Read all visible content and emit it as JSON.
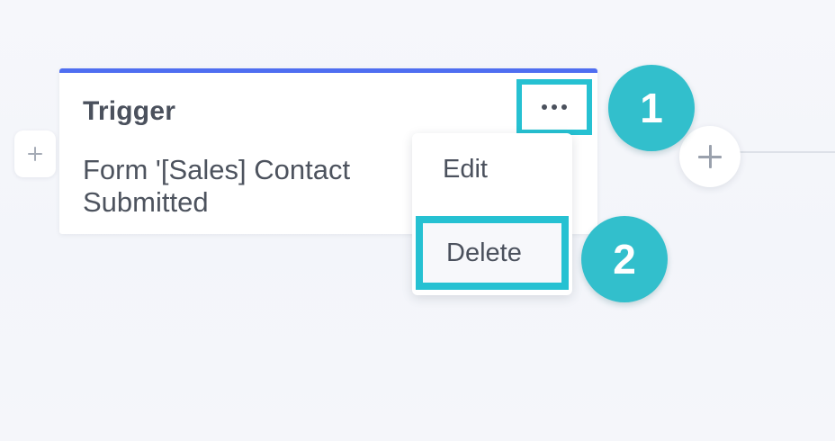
{
  "card": {
    "title": "Trigger",
    "description_line1": "Form '[Sales] Contact",
    "description_line2": "Submitted",
    "accent_color": "#4f6ef1"
  },
  "controls": {
    "more_options_icon": "more-options-dots-icon",
    "left_add_icon": "plus-icon",
    "right_add_icon": "plus-icon"
  },
  "menu": {
    "items": [
      {
        "label": "Edit"
      },
      {
        "label": "Delete"
      }
    ]
  },
  "callouts": {
    "step_1": "1",
    "step_2": "2",
    "highlight_color": "#26c1d2"
  }
}
